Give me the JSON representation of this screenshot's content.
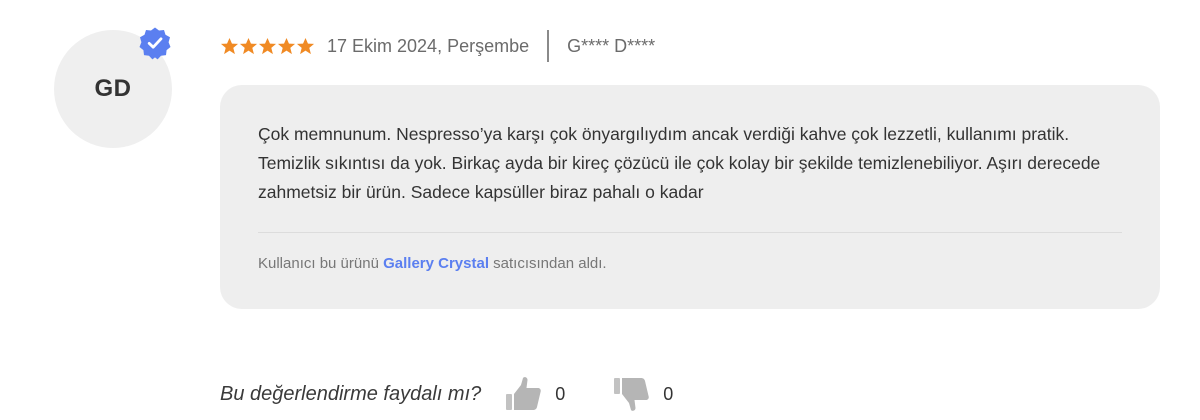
{
  "reviewer": {
    "initials": "GD",
    "name_masked": "G**** D****",
    "verified": true
  },
  "review": {
    "rating": 5,
    "rating_max": 5,
    "date": "17 Ekim 2024, Perşembe",
    "text": "Çok memnunum. Nespresso’ya karşı çok önyargılıydım ancak verdiği kahve çok lezzetli, kullanımı pratik. Temizlik sıkıntısı da yok. Birkaç ayda bir kireç çözücü ile çok kolay bir şekilde temizlenebiliyor. Aşırı derecede zahmetsiz bir ürün. Sadece kapsüller biraz pahalı o kadar"
  },
  "seller": {
    "prefix": "Kullanıcı bu ürünü",
    "name": "Gallery Crystal",
    "suffix": "satıcısından aldı."
  },
  "helpful": {
    "question": "Bu değerlendirme faydalı mı?",
    "up_count": "0",
    "down_count": "0"
  },
  "icons": {
    "star": "star-icon",
    "verified": "verified-check-badge-icon",
    "thumbs_up": "thumbs-up-icon",
    "thumbs_down": "thumbs-down-icon"
  },
  "colors": {
    "star": "#f08a24",
    "verified_badge": "#5b7ff0",
    "seller_link": "#5b7ff0",
    "bubble_bg": "#eeeeee",
    "avatar_bg": "#efefef",
    "thumb_icon": "#b5b5b5"
  }
}
